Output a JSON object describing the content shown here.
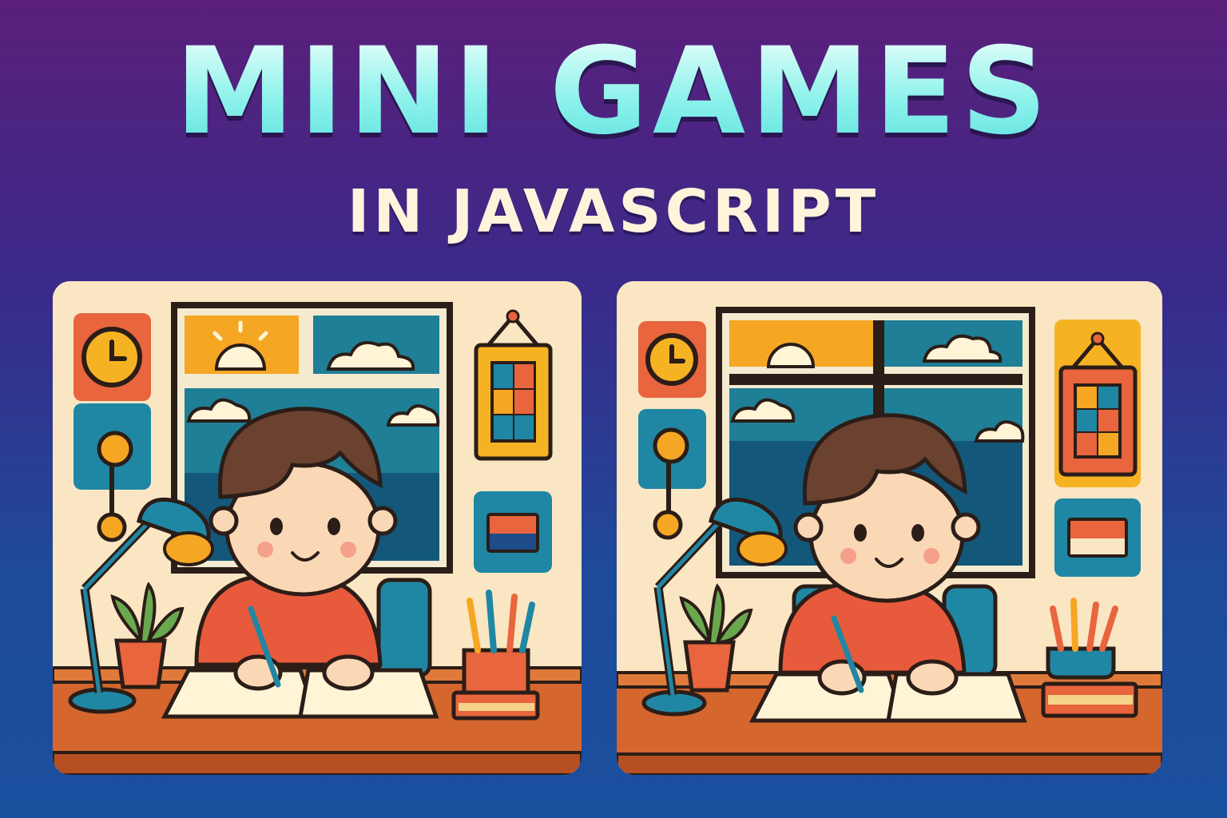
{
  "title": "MINI GAMES",
  "subtitle": "IN JAVASCRIPT",
  "colors": {
    "wall": "#fbe6c4",
    "outline": "#2b1d17",
    "sky": "#1f7f96",
    "sun_sky": "#f5a623",
    "sweater": "#e85a3c",
    "hair": "#6b4130",
    "desk": "#d4662e",
    "lamp": "#2387a8"
  },
  "panels": [
    {
      "name": "scene-left",
      "variant": "original"
    },
    {
      "name": "scene-right",
      "variant": "differences"
    }
  ]
}
